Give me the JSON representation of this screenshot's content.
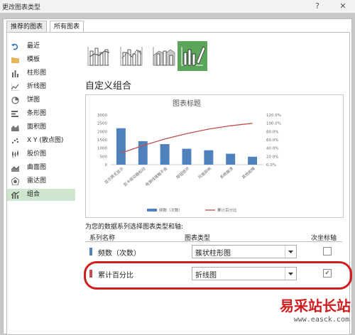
{
  "window": {
    "title": "更改图表类型",
    "help": "?",
    "close": "✕"
  },
  "tabs": [
    {
      "label": "推荐的图表"
    },
    {
      "label": "所有图表"
    }
  ],
  "sidebar": {
    "items": [
      {
        "label": "最近",
        "icon": "undo-icon"
      },
      {
        "label": "模板",
        "icon": "folder-icon"
      },
      {
        "label": "柱形图",
        "icon": "column-chart-icon"
      },
      {
        "label": "折线图",
        "icon": "line-chart-icon"
      },
      {
        "label": "饼图",
        "icon": "pie-chart-icon"
      },
      {
        "label": "条形图",
        "icon": "bar-chart-icon"
      },
      {
        "label": "面积图",
        "icon": "area-chart-icon"
      },
      {
        "label": "X Y (散点图)",
        "icon": "scatter-chart-icon"
      },
      {
        "label": "股价图",
        "icon": "stock-chart-icon"
      },
      {
        "label": "曲面图",
        "icon": "surface-chart-icon"
      },
      {
        "label": "雷达图",
        "icon": "radar-chart-icon"
      },
      {
        "label": "组合",
        "icon": "combo-chart-icon"
      }
    ]
  },
  "subtype_thumbs": [
    {
      "icon": "clustered-column-line-icon"
    },
    {
      "icon": "clustered-column-line-secondary-icon"
    },
    {
      "icon": "stacked-area-column-icon"
    },
    {
      "icon": "custom-combo-icon"
    }
  ],
  "section_title": "自定义组合",
  "preview_chart": {
    "chart_data": {
      "type": "bar",
      "title": "图表标题",
      "categories": [
        "显示屏无显示",
        "显卡驱动器松动",
        "电源线接触不良",
        "按钮损坏",
        "风扇异响",
        "系统崩溃",
        "其他故障"
      ],
      "series": [
        {
          "name": "频数（次数）",
          "type": "bar",
          "color": "#4f81bd",
          "values": [
            2200,
            1420,
            1240,
            960,
            870,
            660,
            480
          ]
        },
        {
          "name": "累计百分比",
          "type": "line",
          "axis": "secondary",
          "color": "#c0504d",
          "values": [
            0.28,
            0.46,
            0.62,
            0.75,
            0.86,
            0.94,
            1.0
          ]
        }
      ],
      "ylim": [
        0,
        3000
      ],
      "y_ticks": [
        "0",
        "500",
        "1000",
        "1500",
        "2000",
        "2500",
        "3000"
      ],
      "y2lim": [
        0,
        1.2
      ],
      "y2_ticks": [
        "0.0%",
        "20.0%",
        "40.0%",
        "60.0%",
        "80.0%",
        "100.0%",
        "120.0%"
      ],
      "legend_position": "bottom",
      "grid": false
    }
  },
  "instruction": "为您的数据系列选择图表类型和轴:",
  "grid": {
    "headers": {
      "series": "系列名称",
      "type": "图表类型",
      "secondary": "次坐标轴"
    },
    "rows": [
      {
        "name": "频数（次数）",
        "color": "#4f81bd",
        "chart_type": "簇状柱形图",
        "secondary_checked": false,
        "check_mark": ""
      },
      {
        "name": "累计百分比",
        "color": "#c0504d",
        "chart_type": "折线图",
        "secondary_checked": true,
        "check_mark": "✓"
      }
    ]
  },
  "watermark": {
    "text": "易采站长站",
    "url": "www.easck.com"
  }
}
